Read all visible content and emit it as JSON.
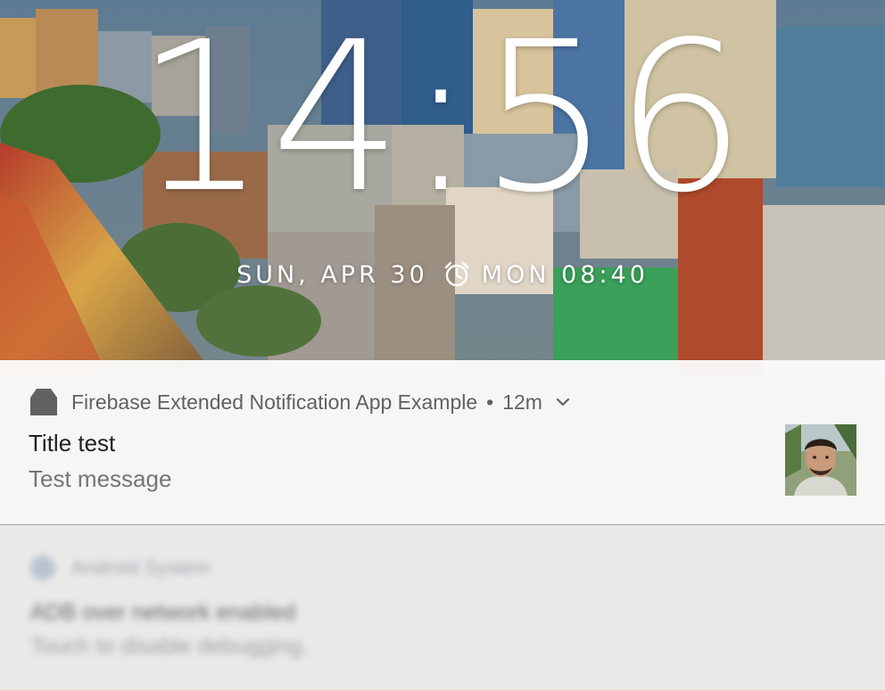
{
  "lockscreen": {
    "time": "14:56",
    "date": "SUN, APR 30",
    "next_alarm": "MON 08:40",
    "alarm_icon": "alarm-clock-icon"
  },
  "notifications": [
    {
      "app_name": "Firebase Extended Notification App Example",
      "separator": "•",
      "time_ago": "12m",
      "app_icon": "generic-app-icon",
      "expand_icon": "chevron-down-icon",
      "title": "Title test",
      "text": "Test message",
      "large_icon": "avatar-photo"
    },
    {
      "app_name": "Android System",
      "title": "ADB over network enabled",
      "text": "Touch to disable debugging."
    }
  ],
  "colors": {
    "panel_background": "#fafafa",
    "title_text": "#212121",
    "secondary_text": "#757575",
    "divider": "#9e9e9e",
    "clock_text": "#ffffff"
  }
}
